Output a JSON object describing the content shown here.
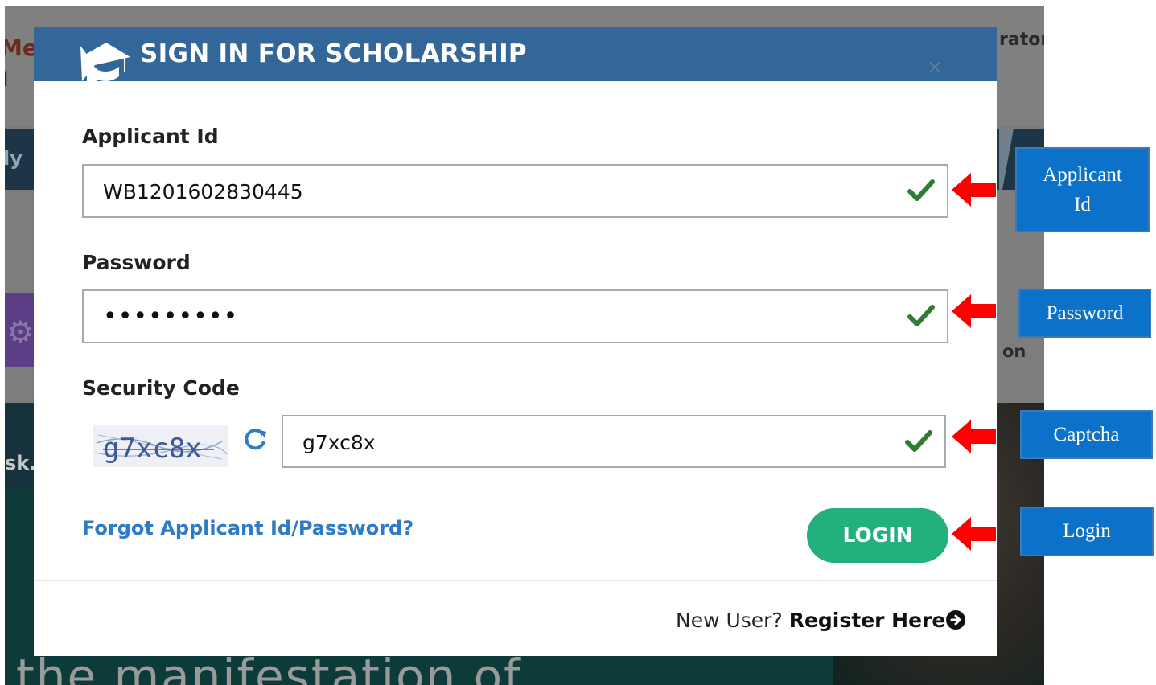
{
  "background": {
    "title_fragment": "Me",
    "title_fragment2": "l",
    "admin_fragment": "rator",
    "nav_fragment": "ly",
    "tile_fragment": "on",
    "hero_fragment": "sk.",
    "hero_text": "the manifestation of"
  },
  "modal": {
    "title": "SIGN IN FOR SCHOLARSHIP",
    "close_symbol": "×",
    "applicant_label": "Applicant Id",
    "applicant_value": "WB1201602830445",
    "password_label": "Password",
    "password_value": "•••••••••",
    "security_label": "Security Code",
    "captcha_image_text": "g7xc8x",
    "captcha_value": "g7xc8x",
    "forgot_link": "Forgot Applicant Id/Password?",
    "login_button": "LOGIN",
    "new_user_prefix": "New User?",
    "register_link": "Register Here"
  },
  "annotations": {
    "applicant_line1": "Applicant",
    "applicant_line2": "Id",
    "password": "Password",
    "captcha": "Captcha",
    "login": "Login",
    "color": "#0b71c9",
    "arrow_color": "#ff0000"
  },
  "colors": {
    "header": "#336699",
    "login_button": "#22b07d",
    "link": "#2f7cc4",
    "check": "#2e7d32"
  },
  "icons": {
    "graduation": "graduation-cap-icon",
    "close": "close-icon",
    "check": "checkmark-icon",
    "refresh": "refresh-icon",
    "register": "arrow-circle-right-icon"
  }
}
